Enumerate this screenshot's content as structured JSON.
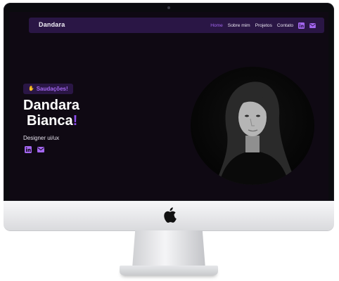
{
  "nav": {
    "brand": "Dandara",
    "links": [
      {
        "label": "Home",
        "active": true
      },
      {
        "label": "Sobre mim",
        "active": false
      },
      {
        "label": "Projetos",
        "active": false
      },
      {
        "label": "Contato",
        "active": false
      }
    ],
    "icons": [
      "linkedin-icon",
      "mail-icon"
    ]
  },
  "hero": {
    "greeting": "Saudações!",
    "greeting_icon": "waving-hand-icon",
    "name_line1": "Dandara",
    "name_line2": "Bianca",
    "name_accent": "!",
    "role": "Designer ui/ux",
    "social_icons": [
      "linkedin-icon",
      "mail-icon"
    ]
  },
  "colors": {
    "background": "#0f0913",
    "nav_background": "#2a1645",
    "accent": "#a366f0"
  }
}
